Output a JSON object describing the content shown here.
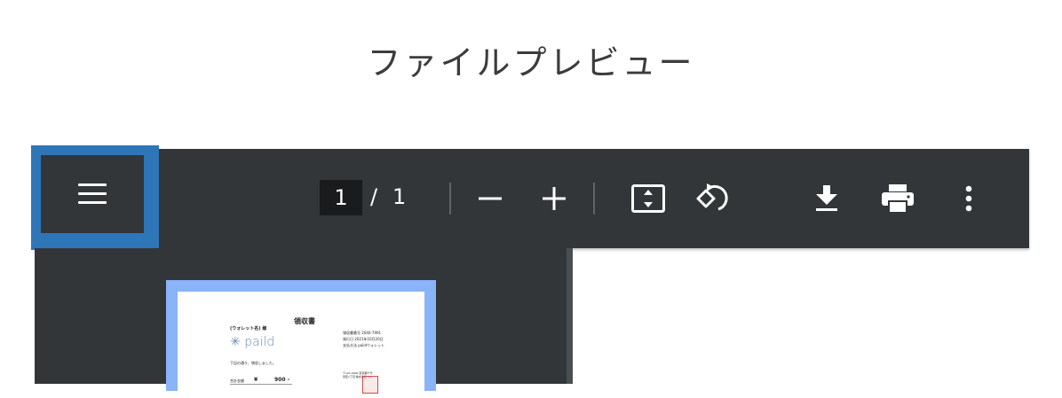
{
  "page": {
    "title": "ファイルプレビュー"
  },
  "toolbar": {
    "current_page": "1",
    "separator": "/",
    "total_pages": "1",
    "icons": [
      "menu-icon",
      "zoom-out-icon",
      "zoom-in-icon",
      "fit-page-icon",
      "rotate-icon",
      "download-icon",
      "print-icon",
      "more-vert-icon"
    ]
  },
  "thumbnail": {
    "doc_title": "領収書",
    "addressee": "(ウォレット名) 様",
    "logo_text": "paild",
    "receipt_number": "領収書番号 2040-7991",
    "issue_date": "発行日 2021年10月20日",
    "issuer": "支払方法 paildウォレット",
    "body_text": "下記の通り、領収しました。",
    "amount_label": "合計金額",
    "amount_currency": "¥",
    "amount_value": "900 -",
    "company_address": "〒101-0000 東京都千代田区1丁目 株式会社 ○○"
  },
  "colors": {
    "toolbar": "#323639",
    "highlight": "#2f76b8",
    "thumb_border": "#8ab4f8"
  }
}
